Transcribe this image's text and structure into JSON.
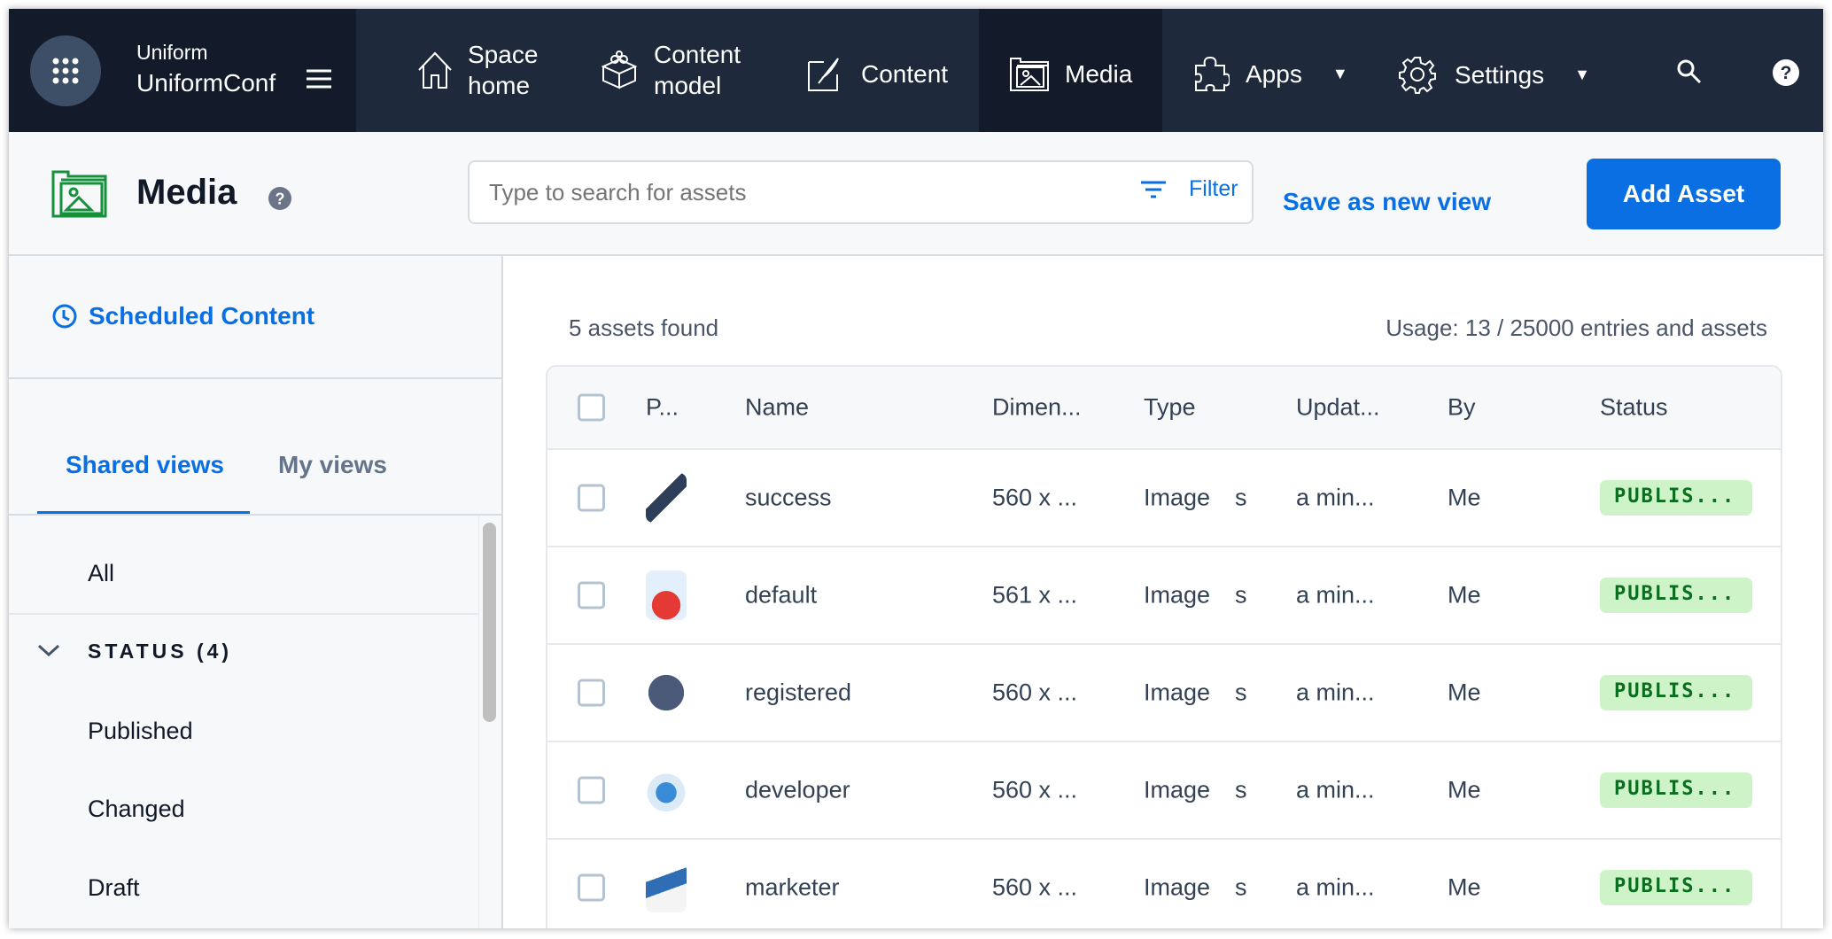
{
  "nav": {
    "org": "Uniform",
    "project": "UniformConf",
    "items": [
      {
        "line1": "Space",
        "line2": "home",
        "icon": "home-icon"
      },
      {
        "line1": "Content",
        "line2": "model",
        "icon": "blocks-icon"
      },
      {
        "label": "Content",
        "icon": "pen-icon"
      },
      {
        "label": "Media",
        "icon": "media-icon"
      },
      {
        "label": "Apps",
        "icon": "puzzle-icon"
      },
      {
        "label": "Settings",
        "icon": "gear-icon"
      }
    ]
  },
  "header": {
    "title": "Media",
    "search_placeholder": "Type to search for assets",
    "filter_label": "Filter",
    "save_view_label": "Save as new view",
    "add_asset_label": "Add Asset"
  },
  "sidebar": {
    "scheduled": "Scheduled Content",
    "tabs": [
      "Shared views",
      "My views"
    ],
    "all": "All",
    "status_group": "STATUS (4)",
    "status_items": [
      "Published",
      "Changed",
      "Draft"
    ]
  },
  "main": {
    "count": "5 assets found",
    "usage": "Usage: 13 / 25000 entries and assets"
  },
  "table": {
    "headers": [
      "P...",
      "Name",
      "Dimen...",
      "Type",
      "Updat...",
      "By",
      "Status"
    ],
    "rows": [
      {
        "name": "success",
        "dim": "560 x ...",
        "type": "Image",
        "type2": "s",
        "updated": "a min...",
        "by": "Me",
        "status": "PUBLIS..."
      },
      {
        "name": "default",
        "dim": "561 x ...",
        "type": "Image",
        "type2": "s",
        "updated": "a min...",
        "by": "Me",
        "status": "PUBLIS..."
      },
      {
        "name": "registered",
        "dim": "560 x ...",
        "type": "Image",
        "type2": "s",
        "updated": "a min...",
        "by": "Me",
        "status": "PUBLIS..."
      },
      {
        "name": "developer",
        "dim": "560 x ...",
        "type": "Image",
        "type2": "s",
        "updated": "a min...",
        "by": "Me",
        "status": "PUBLIS..."
      },
      {
        "name": "marketer",
        "dim": "560 x ...",
        "type": "Image",
        "type2": "s",
        "updated": "a min...",
        "by": "Me",
        "status": "PUBLIS..."
      }
    ]
  },
  "colors": {
    "accent": "#0a6fe3",
    "nav": "#1e293b",
    "nav_dark": "#131b2b",
    "badge_bg": "#cff3c9",
    "badge_text": "#0b6e1f"
  }
}
